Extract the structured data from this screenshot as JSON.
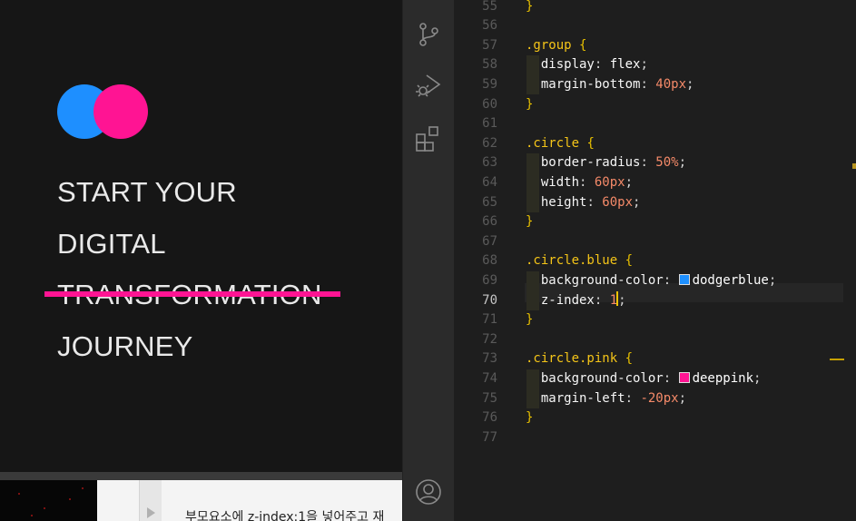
{
  "preview": {
    "colors": {
      "background": "#161616",
      "blue_circle": "#1e8fff",
      "pink_circle": "#ff1493",
      "strike": "#ff1493",
      "text": "#e9e9e9"
    },
    "headline_lines": [
      "START YOUR",
      "DIGITAL",
      "TRANSFORMATION",
      "JOURNEY"
    ],
    "struck_line_index": 2
  },
  "bottom_strip": {
    "text": "부모요소에  z-index:1을 넣어주고 재"
  },
  "activity_bar": {
    "icons": [
      "source-control-icon",
      "run-debug-icon",
      "extensions-icon",
      "account-icon"
    ]
  },
  "editor": {
    "active_line": "70",
    "lines": [
      {
        "n": "55",
        "code": "}"
      },
      {
        "n": "56",
        "code": ""
      },
      {
        "n": "57",
        "code": ".group {"
      },
      {
        "n": "58",
        "code": "  display: flex;"
      },
      {
        "n": "59",
        "code": "  margin-bottom: 40px;"
      },
      {
        "n": "60",
        "code": "}"
      },
      {
        "n": "61",
        "code": ""
      },
      {
        "n": "62",
        "code": ".circle {"
      },
      {
        "n": "63",
        "code": "  border-radius: 50%;"
      },
      {
        "n": "64",
        "code": "  width: 60px;"
      },
      {
        "n": "65",
        "code": "  height: 60px;"
      },
      {
        "n": "66",
        "code": "}"
      },
      {
        "n": "67",
        "code": ""
      },
      {
        "n": "68",
        "code": ".circle.blue {"
      },
      {
        "n": "69",
        "code": "  background-color: dodgerblue;"
      },
      {
        "n": "70",
        "code": "  z-index: 1;"
      },
      {
        "n": "71",
        "code": "}"
      },
      {
        "n": "72",
        "code": ""
      },
      {
        "n": "73",
        "code": ".circle.pink {"
      },
      {
        "n": "74",
        "code": "  background-color: deeppink;"
      },
      {
        "n": "75",
        "code": "  margin-left: -20px;"
      },
      {
        "n": "76",
        "code": "}"
      },
      {
        "n": "77",
        "code": ""
      }
    ],
    "color_swatches": {
      "dodgerblue": "#1e90ff",
      "deeppink": "#ff1493"
    }
  }
}
